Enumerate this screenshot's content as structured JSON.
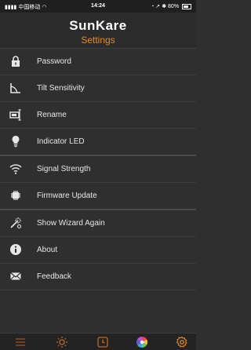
{
  "status_bar": {
    "carrier": "中国移动",
    "time": "14:24",
    "battery": "80%"
  },
  "header": {
    "brand": "SunKare",
    "subtitle": "Settings"
  },
  "menu": {
    "items": [
      {
        "label": "Password",
        "icon": "lock-icon"
      },
      {
        "label": "Tilt Sensitivity",
        "icon": "angle-icon"
      },
      {
        "label": "Rename",
        "icon": "rename-icon"
      },
      {
        "label": "Indicator LED",
        "icon": "bulb-icon"
      },
      {
        "label": "Signal Strength",
        "icon": "wifi-icon"
      },
      {
        "label": "Firmware Update",
        "icon": "chip-icon"
      },
      {
        "label": "Show Wizard Again",
        "icon": "wand-icon"
      },
      {
        "label": "About",
        "icon": "info-icon"
      },
      {
        "label": "Feedback",
        "icon": "mail-icon"
      }
    ]
  },
  "tabs": [
    {
      "name": "menu-tab",
      "icon": "list-icon",
      "active": false
    },
    {
      "name": "sun-tab",
      "icon": "sun-icon",
      "active": false
    },
    {
      "name": "timer-tab",
      "icon": "clock-icon",
      "active": false
    },
    {
      "name": "color-tab",
      "icon": "color-wheel-icon",
      "active": false
    },
    {
      "name": "settings-tab",
      "icon": "gear-icon",
      "active": true
    }
  ],
  "colors": {
    "accent": "#e88a26",
    "background": "#2f2f2f",
    "text": "#e6e6e6"
  }
}
